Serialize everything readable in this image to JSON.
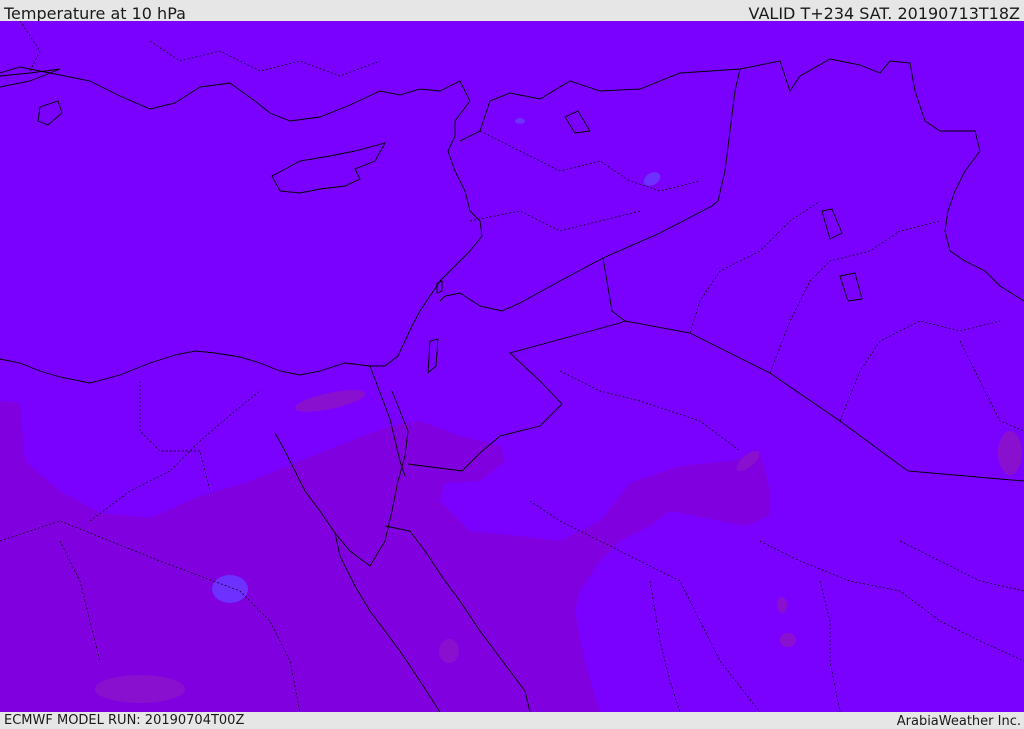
{
  "header": {
    "title": "Temperature at 10 hPa",
    "valid_time": "VALID T+234 SAT. 20190713T18Z"
  },
  "footer": {
    "model_run": "ECMWF MODEL RUN: 20190704T00Z",
    "credit": "ArabiaWeather Inc."
  },
  "map": {
    "colors": {
      "background_field": "#7a00ff",
      "warm_field": "#8000e0",
      "warmer_patch": "#8a10d0",
      "cool_patch": "#6e30ff",
      "lake_fill": "#7a00ff",
      "border_line": "#000000",
      "frame": "#e6e6e6"
    }
  }
}
